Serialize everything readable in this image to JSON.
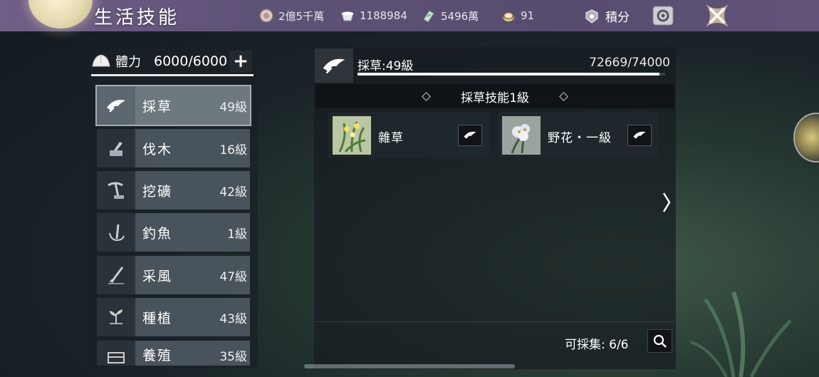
{
  "header": {
    "title": "生活技能",
    "currencies": [
      {
        "icon": "silver-coin-icon",
        "value": "2億5千萬"
      },
      {
        "icon": "teacup-icon",
        "value": "1188984"
      },
      {
        "icon": "jade-ticket-icon",
        "value": "5496萬"
      },
      {
        "icon": "gold-ingot-icon",
        "value": "91"
      }
    ],
    "points_label": "積分"
  },
  "stamina": {
    "label": "體力",
    "value": "6000/6000"
  },
  "skills": [
    {
      "name": "採草",
      "level": "49級",
      "icon": "herb-hand-icon",
      "active": true
    },
    {
      "name": "伐木",
      "level": "16級",
      "icon": "axe-stump-icon",
      "active": false
    },
    {
      "name": "挖礦",
      "level": "42級",
      "icon": "pickaxe-icon",
      "active": false
    },
    {
      "name": "釣魚",
      "level": "1級",
      "icon": "fishing-rod-icon",
      "active": false
    },
    {
      "name": "采風",
      "level": "47級",
      "icon": "brush-icon",
      "active": false
    },
    {
      "name": "種植",
      "level": "43級",
      "icon": "sprout-icon",
      "active": false
    },
    {
      "name": "養殖",
      "level": "35級",
      "icon": "pen-icon",
      "active": false
    }
  ],
  "detail": {
    "title": "採草:49級",
    "exp": "72669/74000",
    "exp_ratio": 0.982,
    "tier": "採草技能1級",
    "materials": [
      {
        "name": "雜草",
        "icon": "weed-icon"
      },
      {
        "name": "野花・一級",
        "icon": "wildflower-icon"
      }
    ],
    "collect_label": "可採集: 6/6"
  },
  "colors": {
    "topbar": "#5f5277",
    "panel": "#1a2026",
    "active_skill": "#78838a"
  }
}
